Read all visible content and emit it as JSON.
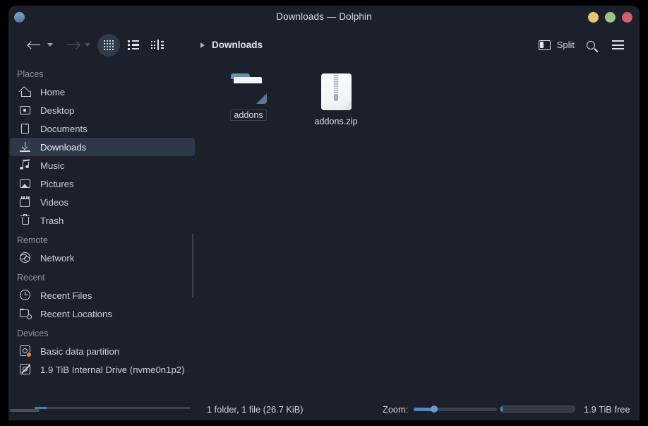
{
  "window": {
    "title": "Downloads — Dolphin",
    "app_icon": "dolphin-app-icon",
    "controls": {
      "minimize": {
        "name": "minimize-button",
        "color": "#e8c47a"
      },
      "maximize": {
        "name": "maximize-button",
        "color": "#9ac58a"
      },
      "close": {
        "name": "close-button",
        "color": "#cd5f6e"
      }
    }
  },
  "toolbar": {
    "back": {
      "icon": "arrow-left-icon",
      "enabled": true
    },
    "back_dropdown": {
      "icon": "chevron-down-icon",
      "enabled": true
    },
    "forward": {
      "icon": "arrow-right-icon",
      "enabled": false
    },
    "forward_dropdown": {
      "icon": "chevron-down-icon",
      "enabled": false
    },
    "view_modes": [
      {
        "name": "view-mode-icons",
        "icon": "grid-dots-icon",
        "active": true
      },
      {
        "name": "view-mode-compact",
        "icon": "list-icon",
        "active": false
      },
      {
        "name": "view-mode-details",
        "icon": "details-columns-icon",
        "active": false
      }
    ],
    "split_label": "Split",
    "split_icon": "split-panes-icon",
    "search_icon": "search-icon",
    "menu_icon": "hamburger-menu-icon"
  },
  "breadcrumb": {
    "expand_icon": "chevron-right-icon",
    "current": "Downloads"
  },
  "sidebar": {
    "groups": [
      {
        "title": "Places",
        "items": [
          {
            "label": "Home",
            "icon": "home-icon",
            "selected": false
          },
          {
            "label": "Desktop",
            "icon": "desktop-monitor-icon",
            "selected": false
          },
          {
            "label": "Documents",
            "icon": "document-icon",
            "selected": false
          },
          {
            "label": "Downloads",
            "icon": "download-arrow-icon",
            "selected": true
          },
          {
            "label": "Music",
            "icon": "music-note-icon",
            "selected": false
          },
          {
            "label": "Pictures",
            "icon": "picture-image-icon",
            "selected": false
          },
          {
            "label": "Videos",
            "icon": "video-film-icon",
            "selected": false
          },
          {
            "label": "Trash",
            "icon": "trash-bin-icon",
            "selected": false
          }
        ]
      },
      {
        "title": "Remote",
        "items": [
          {
            "label": "Network",
            "icon": "network-globe-icon",
            "selected": false
          }
        ]
      },
      {
        "title": "Recent",
        "items": [
          {
            "label": "Recent Files",
            "icon": "clock-icon",
            "selected": false
          },
          {
            "label": "Recent Locations",
            "icon": "folder-clock-icon",
            "selected": false
          }
        ]
      },
      {
        "title": "Devices",
        "items": [
          {
            "label": "Basic data partition",
            "icon": "hard-disk-icon",
            "selected": false,
            "badge": "warning-badge-icon"
          },
          {
            "label": "1.9 TiB Internal Drive (nvme0n1p2)",
            "icon": "hard-disk-unmounted-icon",
            "selected": false,
            "capacity_percent": 8
          }
        ]
      }
    ]
  },
  "main": {
    "files": [
      {
        "name": "addons",
        "type": "folder",
        "icon": "folder-icon",
        "focused": true
      },
      {
        "name": "addons.zip",
        "type": "archive",
        "icon": "zip-archive-icon",
        "focused": false
      }
    ]
  },
  "statusbar": {
    "count_text": "1 folder, 1 file (26.7 KiB)",
    "zoom_label": "Zoom:",
    "zoom_percent": 24,
    "free_space_text": "1.9 TiB free",
    "free_used_percent": 3
  },
  "colors": {
    "window_bg": "#1b202a",
    "selection": "#2e3848",
    "accent": "#5a83b8",
    "folder": "#6d8eb6",
    "text": "#ccd2db",
    "muted_text": "#8b93a1"
  }
}
